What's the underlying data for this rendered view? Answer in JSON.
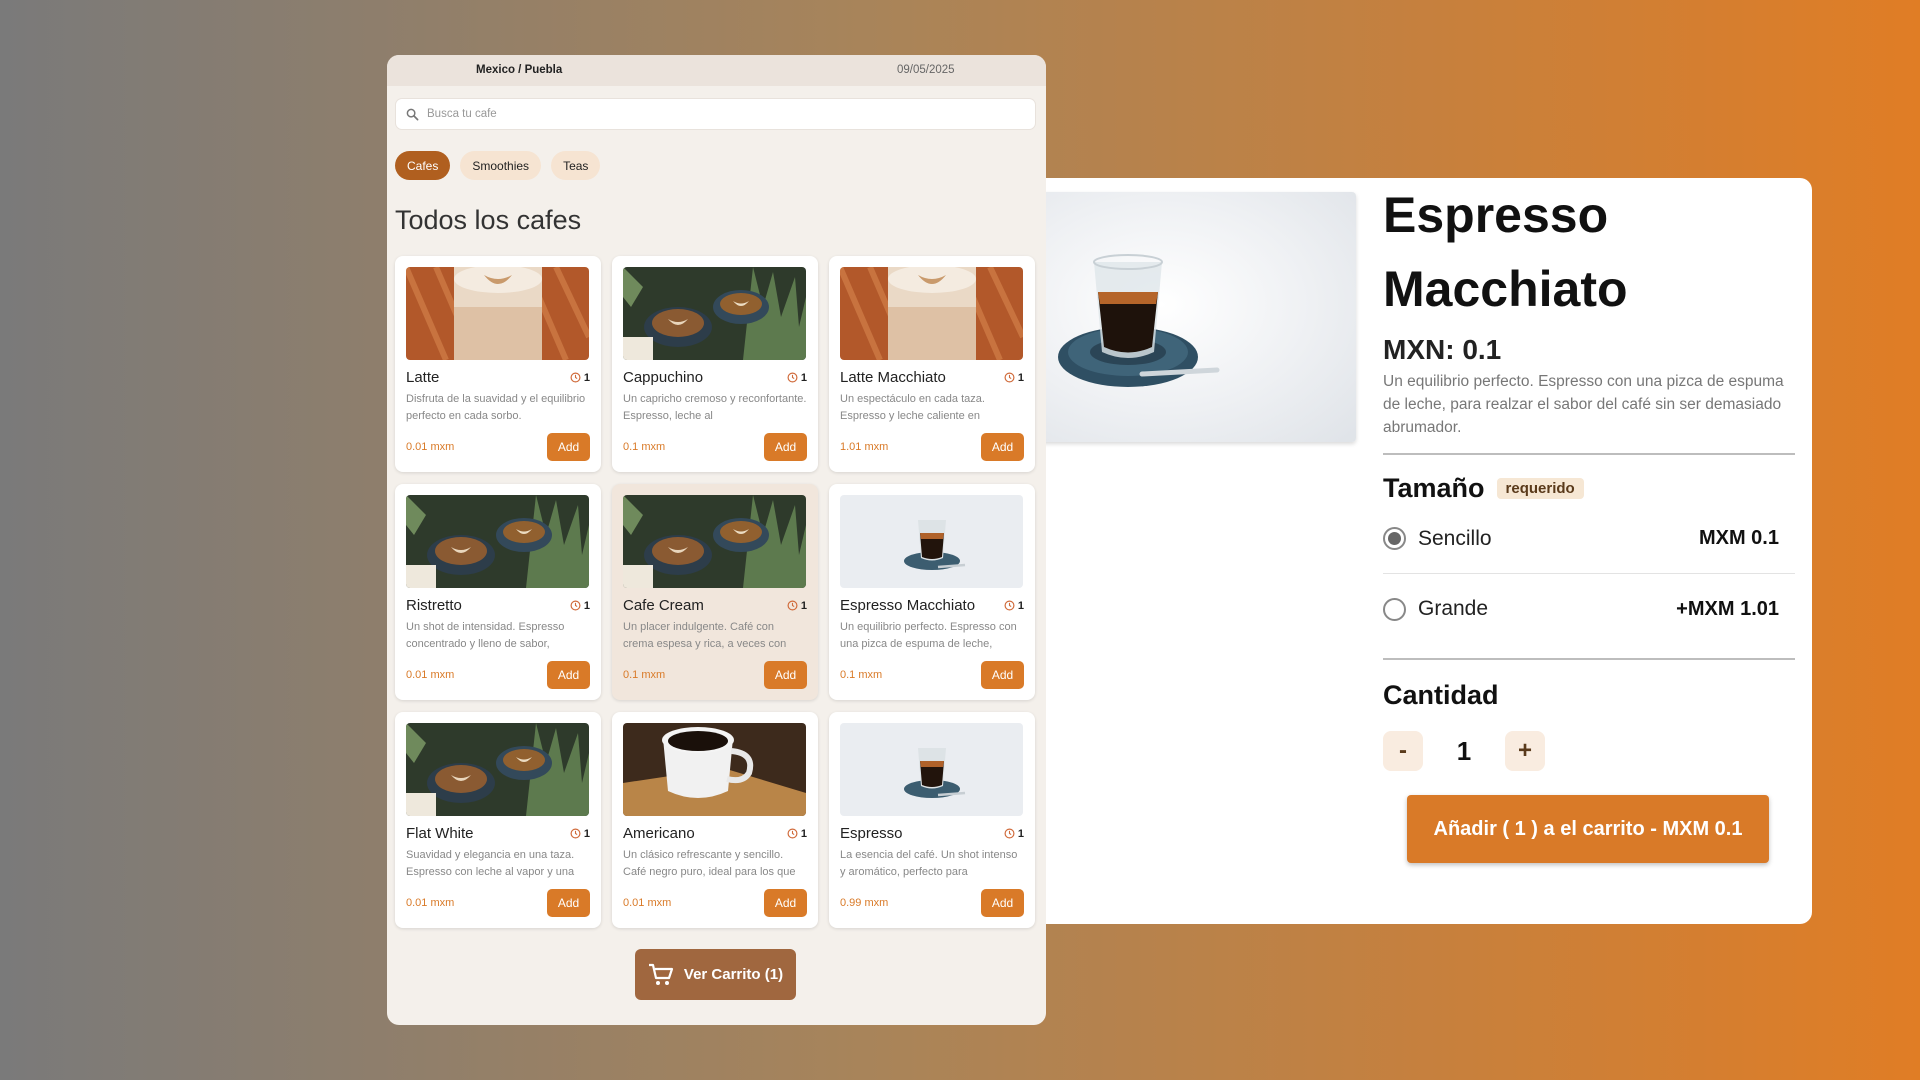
{
  "colors": {
    "accent": "#d97a28",
    "active_tab": "#b05f1f",
    "cart_button": "#a0673f",
    "app_background": "#f4f0eb"
  },
  "app": {
    "location": "Mexico / Puebla",
    "date": "09/05/2025",
    "search": {
      "placeholder": "Busca tu cafe",
      "icon": "search-icon"
    },
    "tabs": [
      {
        "label": "Cafes",
        "active": true
      },
      {
        "label": "Smoothies",
        "active": false
      },
      {
        "label": "Teas",
        "active": false
      }
    ],
    "heading": "Todos los cafes",
    "products": [
      {
        "name": "Latte",
        "time": "1",
        "desc": "Disfruta de la suavidad y el equilibrio perfecto en cada sorbo.",
        "price": "0.01 mxm",
        "add": "Add",
        "image": "latte-art-glass"
      },
      {
        "name": "Cappuchino",
        "time": "1",
        "desc": "Un capricho cremoso y reconfortante. Espresso, leche al",
        "price": "0.1 mxm",
        "add": "Add",
        "image": "cups-with-plants"
      },
      {
        "name": "Latte Macchiato",
        "time": "1",
        "desc": "Un espectáculo en cada taza. Espresso y leche caliente en",
        "price": "1.01 mxm",
        "add": "Add",
        "image": "latte-art-glass"
      },
      {
        "name": "Ristretto",
        "time": "1",
        "desc": "Un shot de intensidad. Espresso concentrado y lleno de sabor,",
        "price": "0.01 mxm",
        "add": "Add",
        "image": "cups-with-plants"
      },
      {
        "name": "Cafe Cream",
        "time": "1",
        "desc": "Un placer indulgente. Café con crema espesa y rica, a veces con",
        "price": "0.1 mxm",
        "add": "Add",
        "image": "cups-with-plants"
      },
      {
        "name": "Espresso Macchiato",
        "time": "1",
        "desc": "Un equilibrio perfecto. Espresso con una pizca de espuma de leche,",
        "price": "0.1 mxm",
        "add": "Add",
        "image": "espresso-glass"
      },
      {
        "name": "Flat White",
        "time": "1",
        "desc": "Suavidad y elegancia en una taza. Espresso con leche al vapor y una",
        "price": "0.01 mxm",
        "add": "Add",
        "image": "cups-with-plants"
      },
      {
        "name": "Americano",
        "time": "1",
        "desc": "Un clásico refrescante y sencillo. Café negro puro, ideal para los que",
        "price": "0.01 mxm",
        "add": "Add",
        "image": "black-coffee-cup"
      },
      {
        "name": "Espresso",
        "time": "1",
        "desc": "La esencia del café. Un shot intenso y aromático, perfecto para",
        "price": "0.99 mxm",
        "add": "Add",
        "image": "espresso-glass"
      }
    ],
    "cart_button": "Ver Carrito (1)"
  },
  "detail": {
    "title_line1": "Espresso",
    "title_line2": "Macchiato",
    "price": "MXN: 0.1",
    "description": "Un equilibrio perfecto. Espresso con una pizca de espuma de leche, para realzar el sabor del café sin ser demasiado abrumador.",
    "size": {
      "title": "Tamaño",
      "badge": "requerido",
      "options": [
        {
          "label": "Sencillo",
          "price": "MXM 0.1",
          "selected": true
        },
        {
          "label": "Grande",
          "price": "+MXM 1.01",
          "selected": false
        }
      ]
    },
    "quantity": {
      "title": "Cantidad",
      "minus": "-",
      "value": "1",
      "plus": "+"
    },
    "add_button": "Añadir ( 1 ) a el carrito  - MXM 0.1"
  }
}
